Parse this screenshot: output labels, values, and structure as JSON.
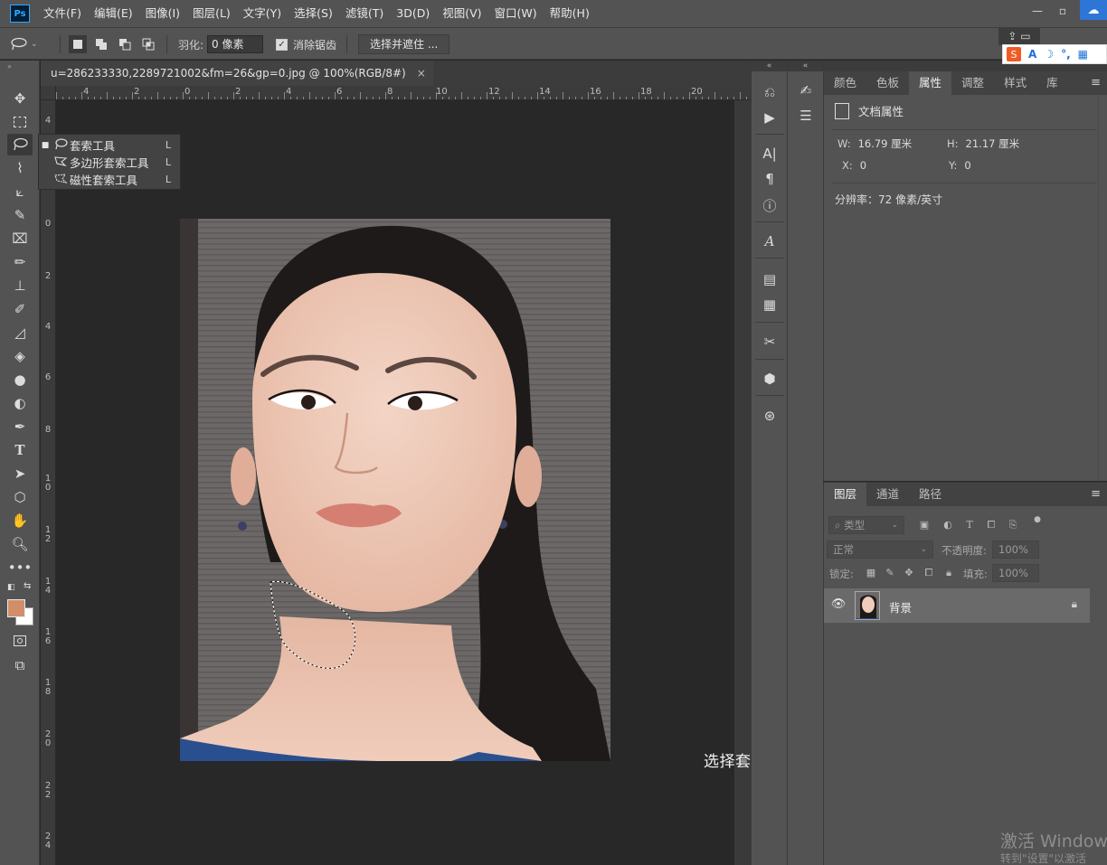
{
  "app": {
    "logo": "Ps"
  },
  "menu": [
    "文件(F)",
    "编辑(E)",
    "图像(I)",
    "图层(L)",
    "文字(Y)",
    "选择(S)",
    "滤镜(T)",
    "3D(D)",
    "视图(V)",
    "窗口(W)",
    "帮助(H)"
  ],
  "window_controls": {
    "minimize": "—",
    "restore": "▫",
    "close": "✕"
  },
  "options": {
    "feather_label": "羽化:",
    "feather_value": "0 像素",
    "antialias_label": "消除锯齿",
    "antialias_checked": true,
    "select_mask_button": "选择并遮住 ..."
  },
  "document": {
    "tab_title": "u=286233330,2289721002&fm=26&gp=0.jpg @ 100%(RGB/8#)",
    "tab_close": "×",
    "ruler_h": [
      "4",
      "2",
      "0",
      "2",
      "4",
      "6",
      "8",
      "10",
      "12",
      "14",
      "16",
      "18",
      "20"
    ],
    "ruler_v": [
      "4",
      "2",
      "0",
      "2",
      "4",
      "6",
      "8",
      "1 0",
      "1 2",
      "1 4",
      "1 6",
      "1 8",
      "2 0",
      "2 2",
      "2 4"
    ]
  },
  "flyout": {
    "items": [
      {
        "label": "套索工具",
        "key": "L",
        "selected": true,
        "icon": "lasso-icon"
      },
      {
        "label": "多边形套索工具",
        "key": "L",
        "selected": false,
        "icon": "polygonal-lasso-icon"
      },
      {
        "label": "磁性套索工具",
        "key": "L",
        "selected": false,
        "icon": "magnetic-lasso-icon"
      }
    ]
  },
  "caption": "选择套索工具    套住双下巴",
  "colors": {
    "foreground": "#d18e6a",
    "background": "#ffffff",
    "accent": "#31a8ff"
  },
  "properties_panel": {
    "tabs": [
      "颜色",
      "色板",
      "属性",
      "调整",
      "样式",
      "库"
    ],
    "active_tab": "属性",
    "title": "文档属性",
    "w_label": "W:",
    "w_value": "16.79 厘米",
    "h_label": "H:",
    "h_value": "21.17 厘米",
    "x_label": "X:",
    "x_value": "0",
    "y_label": "Y:",
    "y_value": "0",
    "resolution": "分辨率：72 像素/英寸"
  },
  "layers_panel": {
    "tabs": [
      "图层",
      "通道",
      "路径"
    ],
    "active_tab": "图层",
    "filter_placeholder": "类型",
    "blend_mode": "正常",
    "opacity_label": "不透明度:",
    "opacity_value": "100%",
    "lock_label": "锁定:",
    "fill_label": "填充:",
    "fill_value": "100%",
    "layers": [
      {
        "name": "背景",
        "visible": true,
        "locked": true
      }
    ]
  },
  "ime": {
    "items": [
      "A",
      "☽",
      "°,",
      "▦"
    ]
  },
  "watermark": {
    "line1": "激活 Windows",
    "line2": "转到\"设置\"以激活"
  }
}
